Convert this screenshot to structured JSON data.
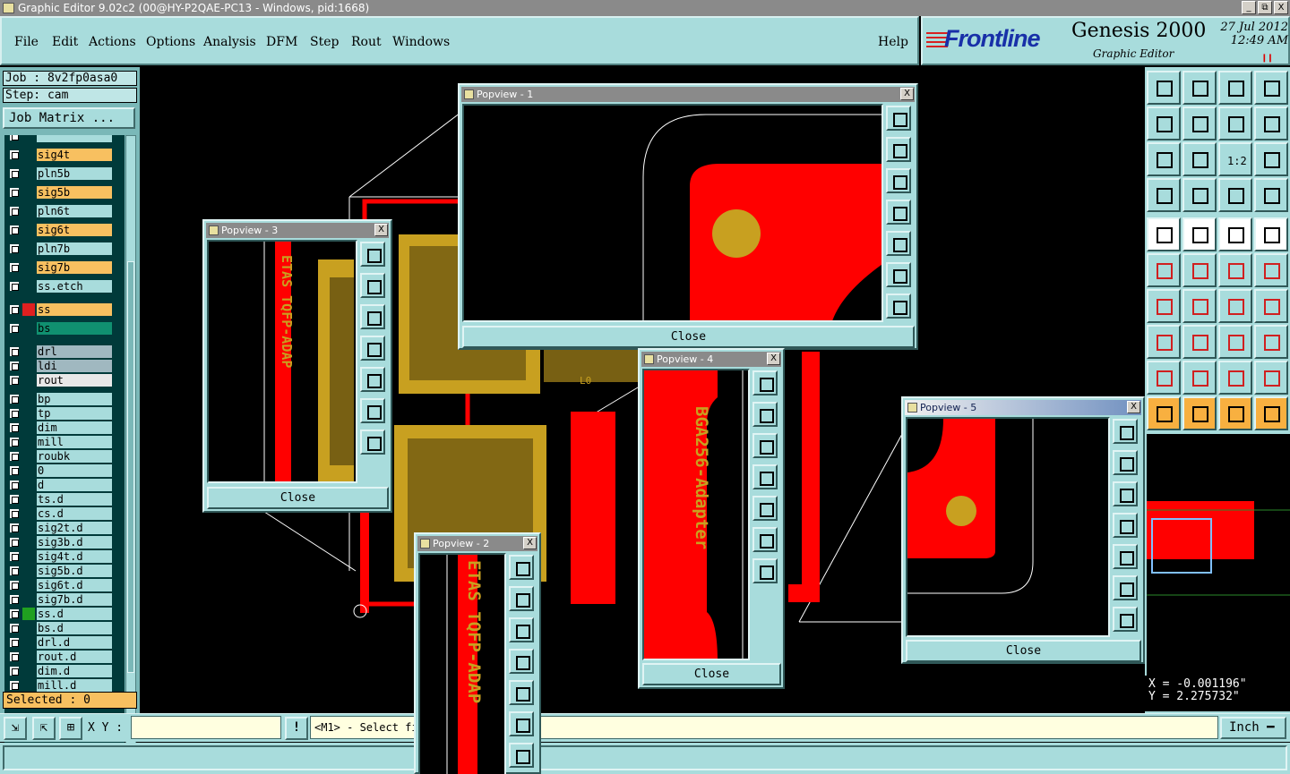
{
  "window": {
    "title": "Graphic Editor 9.02c2 (00@HY-P2QAE-PC13 - Windows, pid:1668)",
    "minimize": "_",
    "maximize": "⧉",
    "close": "X"
  },
  "menu": {
    "file": "File",
    "edit": "Edit",
    "actions": "Actions",
    "options": "Options",
    "analysis": "Analysis",
    "dfm": "DFM",
    "step": "Step",
    "rout": "Rout",
    "windows": "Windows",
    "help": "Help"
  },
  "brand": {
    "logo": "Frontline",
    "product": "Genesis 2000",
    "subtitle": "Graphic Editor",
    "date": "27 Jul 2012",
    "time": "12:49 AM",
    "flag": "❙❙"
  },
  "left": {
    "job": "Job : 8v2fp0asa0",
    "step": "Step: cam",
    "job_matrix": "Job Matrix ...",
    "selected": "Selected : 0"
  },
  "layers": [
    {
      "name": "",
      "color": "#a8dcdc"
    },
    {
      "name": "sig4t",
      "color": "#f8c060"
    },
    {
      "name": "pln5b",
      "color": "#a8dcdc"
    },
    {
      "name": "sig5b",
      "color": "#f8c060"
    },
    {
      "name": "pln6t",
      "color": "#a8dcdc"
    },
    {
      "name": "sig6t",
      "color": "#f8c060"
    },
    {
      "name": "pln7b",
      "color": "#a8dcdc"
    },
    {
      "name": "sig7b",
      "color": "#f8c060"
    },
    {
      "name": "ss.etch",
      "color": "#a8dcdc"
    },
    {
      "name": "ss",
      "color": "#f8c060",
      "swatch": "#e02020"
    },
    {
      "name": "bs",
      "color": "#109070"
    },
    {
      "name": "drl",
      "color": "#a0b8c0"
    },
    {
      "name": "ldi",
      "color": "#a0b8c0"
    },
    {
      "name": "rout",
      "color": "#e8e8e8"
    },
    {
      "name": "bp",
      "color": "#a8dcdc"
    },
    {
      "name": "tp",
      "color": "#a8dcdc"
    },
    {
      "name": "dim",
      "color": "#a8dcdc"
    },
    {
      "name": "mill",
      "color": "#a8dcdc"
    },
    {
      "name": "roubk",
      "color": "#a8dcdc"
    },
    {
      "name": "0",
      "color": "#a8dcdc"
    },
    {
      "name": "d",
      "color": "#a8dcdc"
    },
    {
      "name": "ts.d",
      "color": "#a8dcdc"
    },
    {
      "name": "cs.d",
      "color": "#a8dcdc"
    },
    {
      "name": "sig2t.d",
      "color": "#a8dcdc"
    },
    {
      "name": "sig3b.d",
      "color": "#a8dcdc"
    },
    {
      "name": "sig4t.d",
      "color": "#a8dcdc"
    },
    {
      "name": "sig5b.d",
      "color": "#a8dcdc"
    },
    {
      "name": "sig6t.d",
      "color": "#a8dcdc"
    },
    {
      "name": "sig7b.d",
      "color": "#a8dcdc"
    },
    {
      "name": "ss.d",
      "color": "#a8dcdc",
      "swatch": "#20a020"
    },
    {
      "name": "bs.d",
      "color": "#a8dcdc"
    },
    {
      "name": "drl.d",
      "color": "#a8dcdc"
    },
    {
      "name": "rout.d",
      "color": "#a8dcdc"
    },
    {
      "name": "dim.d",
      "color": "#a8dcdc"
    },
    {
      "name": "mill.d",
      "color": "#a8dcdc"
    }
  ],
  "bottom": {
    "xy_label": "X Y :",
    "xy_value": "",
    "prompt_icon": "!",
    "prompt": "<M1> - Select fi",
    "units": "Inch ━"
  },
  "coords": {
    "x": "X = -0.001196\"",
    "y": "Y = 2.275732\""
  },
  "popviews": {
    "p1": {
      "title": "Popview - 1",
      "close": "Close"
    },
    "p2": {
      "title": "Popview - 2",
      "close": "Close"
    },
    "p3": {
      "title": "Popview - 3",
      "close": "Close"
    },
    "p4": {
      "title": "Popview - 4",
      "close": "Close"
    },
    "p5": {
      "title": "Popview - 5",
      "close": "Close"
    }
  },
  "board_text": {
    "etas": "ETAS TQFP-ADAP",
    "bga": "BGA256-Adapter",
    "small": "L0",
    "tool_scale": "1:2"
  },
  "colors": {
    "copper": "#ff0000",
    "gold": "#c8a020",
    "panel": "#a8dcdc",
    "highlight": "#f8c060"
  }
}
